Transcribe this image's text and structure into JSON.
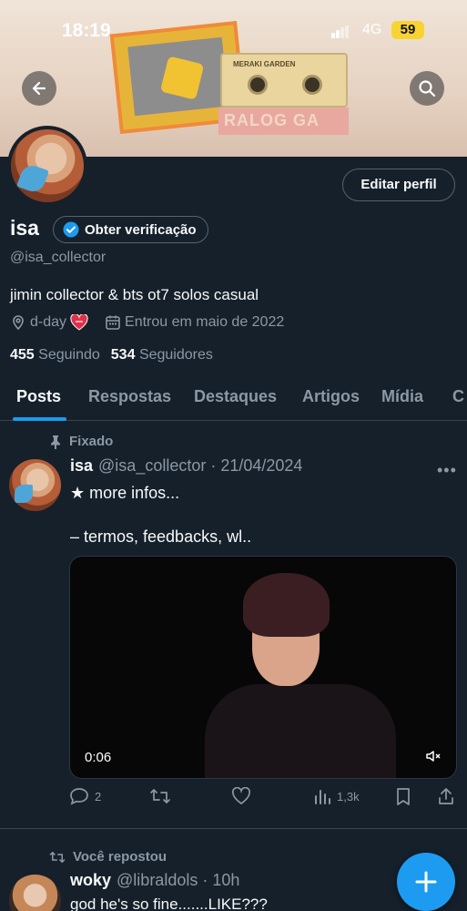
{
  "status_bar": {
    "time": "18:19",
    "network": "4G",
    "battery": "59"
  },
  "banner": {
    "strip_text": "RALOG GA"
  },
  "profile": {
    "edit_label": "Editar perfil",
    "name": "isa",
    "verify_label": "Obter verificação",
    "handle": "@isa_collector",
    "bio": "jimin collector & bts ot7 solos casual",
    "location": "d-day",
    "joined": "Entrou em maio de 2022",
    "following_count": "455",
    "following_label": "Seguindo",
    "followers_count": "534",
    "followers_label": "Seguidores"
  },
  "tabs": [
    {
      "label": "Posts",
      "active": true
    },
    {
      "label": "Respostas"
    },
    {
      "label": "Destaques"
    },
    {
      "label": "Artigos"
    },
    {
      "label": "Mídia"
    },
    {
      "label": "C"
    }
  ],
  "pinned_tweet": {
    "pin_label": "Fixado",
    "name": "isa",
    "handle_date": "@isa_collector · 21/04/2024",
    "text": "★ more infos...\n\n– termos, feedbacks, wl..",
    "video_duration": "0:06",
    "replies": "2",
    "views": "1,3k"
  },
  "second_tweet": {
    "repost_label": "Você repostou",
    "name": "woky",
    "handle_time": "@libraldols · 10h",
    "text": "god he's so fine.......LIKE???"
  },
  "colors": {
    "accent": "#1d9bf0",
    "background": "#15202b",
    "muted": "#8b98a5"
  }
}
